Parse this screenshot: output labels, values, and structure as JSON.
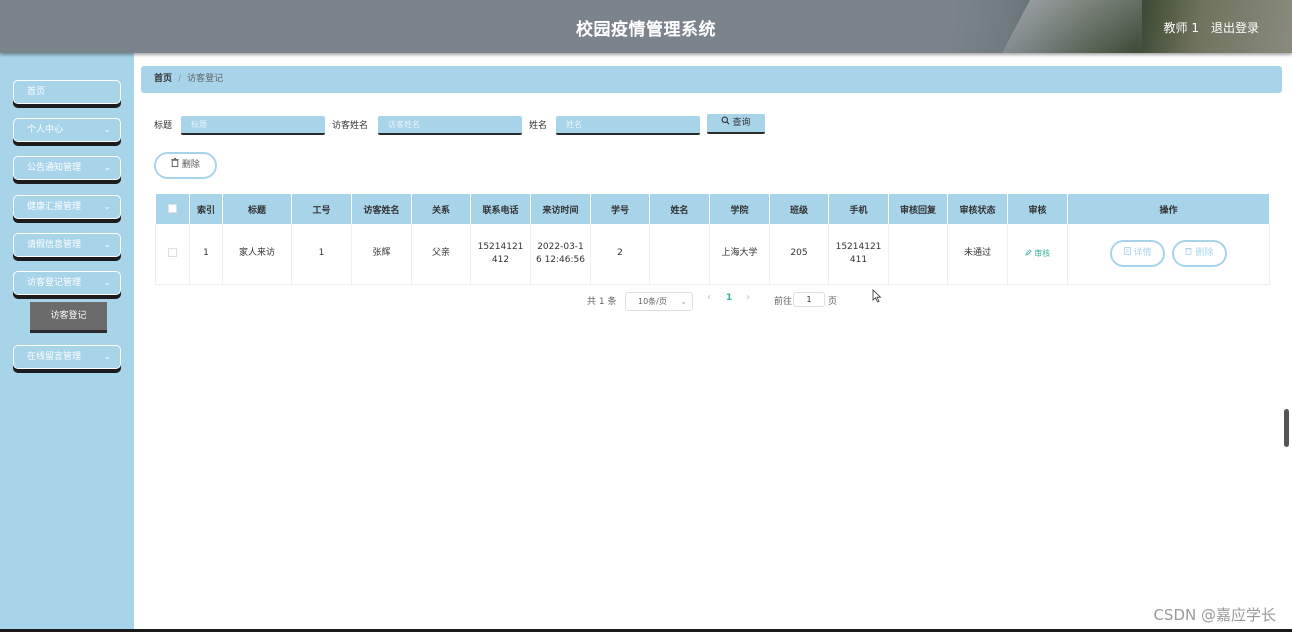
{
  "header": {
    "title": "校园疫情管理系统",
    "user": "教师 1",
    "logout": "退出登录"
  },
  "sidebar": {
    "items": [
      {
        "label": "首页",
        "chevron": false
      },
      {
        "label": "个人中心",
        "chevron": true
      },
      {
        "label": "公告通知管理",
        "chevron": true
      },
      {
        "label": "健康汇报管理",
        "chevron": true
      },
      {
        "label": "请假信息管理",
        "chevron": true
      },
      {
        "label": "访客登记管理",
        "chevron": true
      },
      {
        "label": "在线留言管理",
        "chevron": true
      }
    ],
    "active_sub": "访客登记"
  },
  "breadcrumb": {
    "home": "首页",
    "separator": "/",
    "current": "访客登记"
  },
  "search": {
    "fields": [
      {
        "label": "标题",
        "placeholder": "标题"
      },
      {
        "label": "访客姓名",
        "placeholder": "访客姓名"
      },
      {
        "label": "姓名",
        "placeholder": "姓名"
      }
    ],
    "query_label": "查询"
  },
  "actions": {
    "delete_label": "删除"
  },
  "table": {
    "headers": [
      "",
      "索引",
      "标题",
      "工号",
      "访客姓名",
      "关系",
      "联系电话",
      "来访时间",
      "学号",
      "姓名",
      "学院",
      "班级",
      "手机",
      "审核回复",
      "审核状态",
      "审核",
      "操作"
    ],
    "rows": [
      {
        "index": "1",
        "title": "家人来访",
        "work_no": "1",
        "visitor_name": "张辉",
        "relation": "父亲",
        "phone": "15214121412",
        "visit_time": "2022-03-16 12:46:56",
        "student_no": "2",
        "name": "",
        "college": "上海大学",
        "class": "205",
        "mobile": "15214121411",
        "audit_reply": "",
        "audit_status": "未通过",
        "audit_action": "审核",
        "detail_label": "详情",
        "delete_label": "删除"
      }
    ]
  },
  "pagination": {
    "total": "共 1 条",
    "page_size": "10条/页",
    "current_page": "1",
    "goto_label": "前往",
    "goto_value": "1",
    "page_unit": "页"
  },
  "watermark": "CSDN @嘉应学长",
  "colors": {
    "accent": "#a8d4ea",
    "header": "#7b848c",
    "audit_link": "#39b0a0"
  },
  "icons": {
    "search": "search-icon",
    "trash": "trash-icon",
    "edit": "edit-icon",
    "detail": "document-icon",
    "chevron": "chevron-down-icon"
  }
}
